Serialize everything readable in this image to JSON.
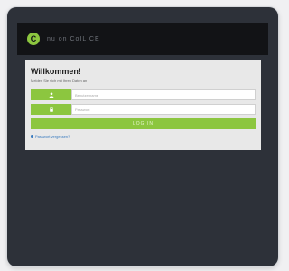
{
  "app": {
    "logo_mark": "C",
    "brand_text": "nu on CoIL CE"
  },
  "login": {
    "title": "Willkommen!",
    "subtitle": "Melden Sie sich mit Ihren Daten an",
    "username_placeholder": "Benutzername",
    "password_placeholder": "Passwort",
    "login_label": "LOG IN",
    "forgot_label": "Passwort vergessen?"
  },
  "icons": {
    "user": "user-icon",
    "lock": "lock-icon",
    "forgot": "info-icon"
  },
  "colors": {
    "accent": "#8cc63f",
    "topbar": "#121316",
    "device": "#2d3139",
    "panel": "#e8e8e8",
    "link": "#3a7bbf"
  }
}
